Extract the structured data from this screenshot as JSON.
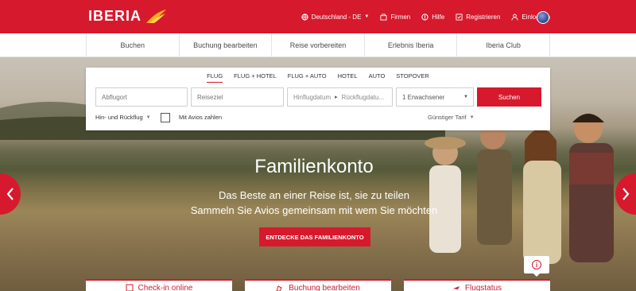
{
  "brand": {
    "name": "IBERIA",
    "accent": "#d7192d"
  },
  "topnav": {
    "country": "Deutschland - DE",
    "business": "Firmen",
    "help": "Hilfe",
    "register": "Registrieren",
    "login": "Einloggen"
  },
  "mainnav": {
    "items": [
      {
        "label": "Buchen"
      },
      {
        "label": "Buchung bearbeiten"
      },
      {
        "label": "Reise vorbereiten"
      },
      {
        "label": "Erlebnis Iberia"
      },
      {
        "label": "Iberia Club"
      }
    ]
  },
  "search": {
    "tabs": [
      {
        "label": "FLUG",
        "active": true
      },
      {
        "label": "FLUG + HOTEL"
      },
      {
        "label": "FLUG + AUTO"
      },
      {
        "label": "HOTEL"
      },
      {
        "label": "AUTO"
      },
      {
        "label": "STOPOVER"
      }
    ],
    "origin_placeholder": "Abflugort",
    "destination_placeholder": "Reiseziel",
    "departure_placeholder": "Hinflugdatum",
    "return_placeholder": "Rückflugdatu...",
    "passengers": "1 Erwachsener",
    "submit": "Suchen",
    "trip_type": "Hin- und Rückflug",
    "avios_label": "Mit Avios zahlen",
    "fare": "Günstiger Tarif"
  },
  "hero": {
    "title": "Familienkonto",
    "subtitle_line1": "Das Beste an einer Reise ist, sie zu teilen",
    "subtitle_line2": "Sammeln Sie Avios gemeinsam mit wem Sie möchten",
    "cta": "ENTDECKE DAS FAMILIENKONTO"
  },
  "cards": [
    {
      "label": "Check-in online",
      "icon": "checkin-icon"
    },
    {
      "label": "Buchung bearbeiten",
      "icon": "edit-icon"
    },
    {
      "label": "Flugstatus",
      "icon": "plane-icon"
    }
  ]
}
